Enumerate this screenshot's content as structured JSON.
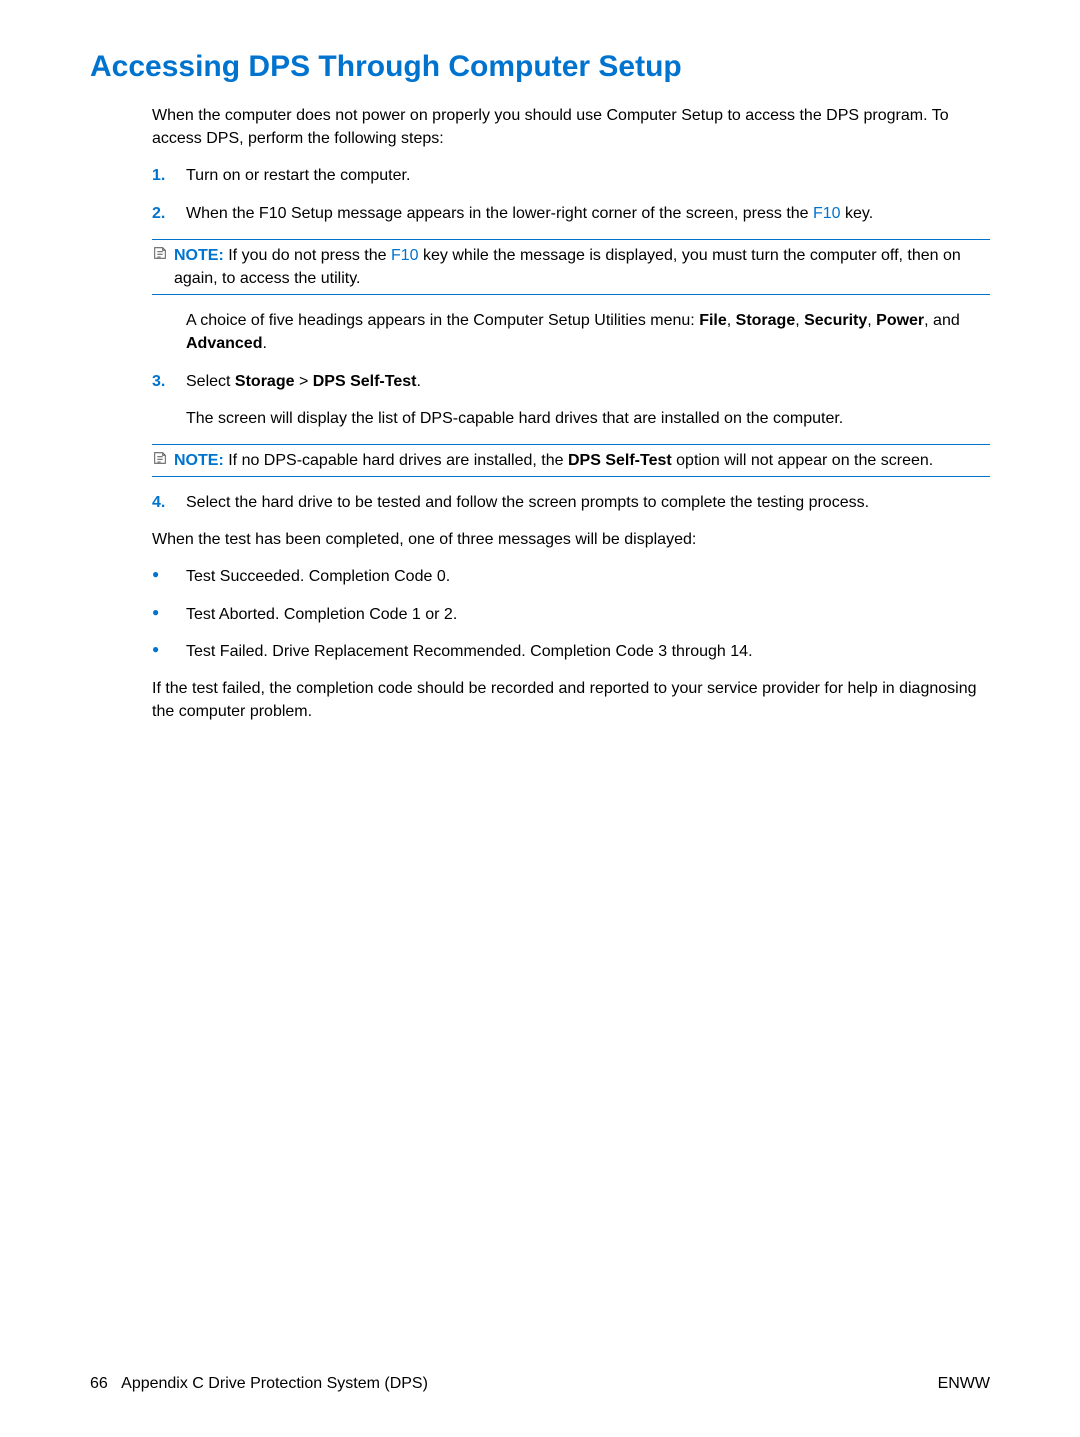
{
  "title": "Accessing DPS Through Computer Setup",
  "intro": "When the computer does not power on properly you should use Computer Setup to access the DPS program. To access DPS, perform the following steps:",
  "steps": {
    "s1": {
      "marker": "1.",
      "text": "Turn on or restart the computer."
    },
    "s2": {
      "marker": "2.",
      "pre": "When the F10 Setup message appears in the lower-right corner of the screen, press the ",
      "key": "F10",
      "post": " key.",
      "note": {
        "label": "NOTE:",
        "pre": "   If you do not press the ",
        "key": "F10",
        "post": " key while the message is displayed, you must turn the computer off, then on again, to access the utility."
      },
      "after_pre": "A choice of five headings appears in the Computer Setup Utilities menu: ",
      "m_file": "File",
      "sep1": ", ",
      "m_storage": "Storage",
      "sep2": ", ",
      "m_security": "Security",
      "sep3": ", ",
      "m_power": "Power",
      "sep4": ", and ",
      "m_advanced": "Advanced",
      "after_post": "."
    },
    "s3": {
      "marker": "3.",
      "pre": "Select ",
      "b1": "Storage",
      "mid": " > ",
      "b2": "DPS Self-Test",
      "post": ".",
      "after": "The screen will display the list of DPS-capable hard drives that are installed on the computer.",
      "note": {
        "label": "NOTE:",
        "pre": "   If no DPS-capable hard drives are installed, the ",
        "bold": "DPS Self-Test",
        "post": " option will not appear on the screen."
      }
    },
    "s4": {
      "marker": "4.",
      "text": "Select the hard drive to be tested and follow the screen prompts to complete the testing process."
    }
  },
  "post_list_intro": "When the test has been completed, one of three messages will be displayed:",
  "bul": {
    "b1": "Test Succeeded. Completion Code 0.",
    "b2": "Test Aborted. Completion Code 1 or 2.",
    "b3": "Test Failed. Drive Replacement Recommended. Completion Code 3 through 14."
  },
  "closing": "If the test failed, the completion code should be recorded and reported to your service provider for help in diagnosing the computer problem.",
  "footer": {
    "page_num": "66",
    "section": "Appendix C   Drive Protection System (DPS)",
    "right": "ENWW"
  }
}
